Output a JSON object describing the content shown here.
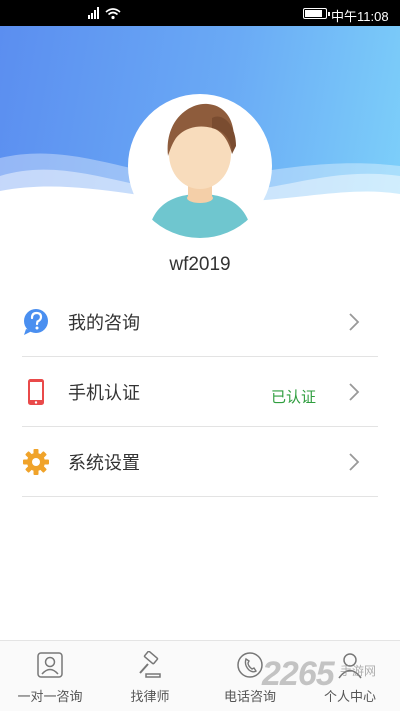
{
  "status_bar": {
    "time": "中午11:08",
    "battery_level": 0.75,
    "signal_icon": "signal-wifi-icon"
  },
  "profile": {
    "avatar_icon": "avatar-icon",
    "username": "wf2019"
  },
  "menu": {
    "items": [
      {
        "label": "我的咨询",
        "icon": "question-icon",
        "value": ""
      },
      {
        "label": "手机认证",
        "icon": "phone-icon",
        "value": "已认证"
      },
      {
        "label": "系统设置",
        "icon": "gear-icon",
        "value": ""
      }
    ]
  },
  "tabbar": {
    "tabs": [
      {
        "label": "一对一咨询",
        "icon": "consult-icon"
      },
      {
        "label": "找律师",
        "icon": "gavel-icon"
      },
      {
        "label": "电话咨询",
        "icon": "telephone-icon"
      },
      {
        "label": "个人中心",
        "icon": "person-icon"
      }
    ]
  },
  "watermark": {
    "text": "2265",
    "sub": "手游网"
  },
  "colors": {
    "header_start": "#5b8ef0",
    "header_end": "#7dd0fa",
    "verified_green": "#2f9e3f",
    "divider": "#e3e3e3"
  }
}
